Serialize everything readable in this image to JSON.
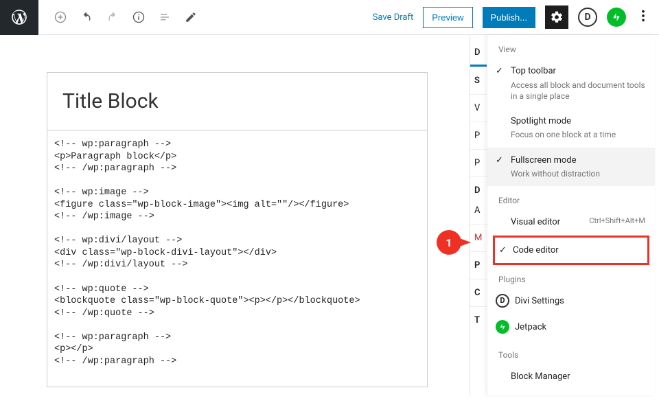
{
  "toolbar": {
    "save_draft": "Save Draft",
    "preview": "Preview",
    "publish": "Publish..."
  },
  "editor": {
    "title": "Title Block",
    "code": "<!-- wp:paragraph -->\n<p>Paragraph block</p>\n<!-- /wp:paragraph -->\n\n<!-- wp:image -->\n<figure class=\"wp-block-image\"><img alt=\"\"/></figure>\n<!-- /wp:image -->\n\n<!-- wp:divi/layout -->\n<div class=\"wp-block-divi-layout\"></div>\n<!-- /wp:divi/layout -->\n\n<!-- wp:quote -->\n<blockquote class=\"wp-block-quote\"><p></p></blockquote>\n<!-- /wp:quote -->\n\n<!-- wp:paragraph -->\n<p></p>\n<!-- /wp:paragraph -->"
  },
  "sidebar": {
    "tab_doc": "D",
    "sec_s": "S",
    "sec_v": "V",
    "sec_p1": "P",
    "sec_p2": "P",
    "sec_d": "D",
    "sec_a": "A",
    "sec_m": "M",
    "sec_p3": "P",
    "sec_c": "C",
    "sec_t": "T"
  },
  "menu": {
    "view_label": "View",
    "top_toolbar": {
      "title": "Top toolbar",
      "desc": "Access all block and document tools in a single place"
    },
    "spotlight": {
      "title": "Spotlight mode",
      "desc": "Focus on one block at a time"
    },
    "fullscreen": {
      "title": "Fullscreen mode",
      "desc": "Work without distraction"
    },
    "editor_label": "Editor",
    "visual": {
      "title": "Visual editor",
      "shortcut": "Ctrl+Shift+Alt+M"
    },
    "code": {
      "title": "Code editor"
    },
    "plugins_label": "Plugins",
    "divi": "Divi Settings",
    "jetpack": "Jetpack",
    "tools_label": "Tools",
    "block_manager": "Block Manager"
  },
  "callout": {
    "num": "1"
  }
}
